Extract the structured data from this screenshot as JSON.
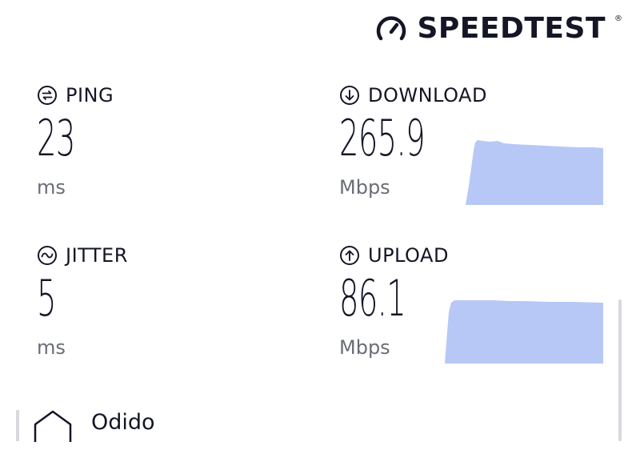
{
  "brand": {
    "name": "SPEEDTEST",
    "registered_mark": "®",
    "logo_icon": "speedometer-icon"
  },
  "colors": {
    "text": "#141526",
    "unit_text": "#6a6d76",
    "graph_fill": "#b7c8f7",
    "scrollbar": "#d8d9de"
  },
  "metrics": {
    "ping": {
      "label": "PING",
      "value": "23",
      "unit": "ms",
      "icon": "ping-arrows-icon"
    },
    "jitter": {
      "label": "JITTER",
      "value": "5",
      "unit": "ms",
      "icon": "jitter-wave-icon"
    },
    "download": {
      "label": "DOWNLOAD",
      "value": "265.9",
      "unit": "Mbps",
      "icon": "download-arrow-icon"
    },
    "upload": {
      "label": "UPLOAD",
      "value": "86.1",
      "unit": "Mbps",
      "icon": "upload-arrow-icon"
    }
  },
  "provider": {
    "name": "Odido",
    "icon": "house-outline-icon"
  }
}
